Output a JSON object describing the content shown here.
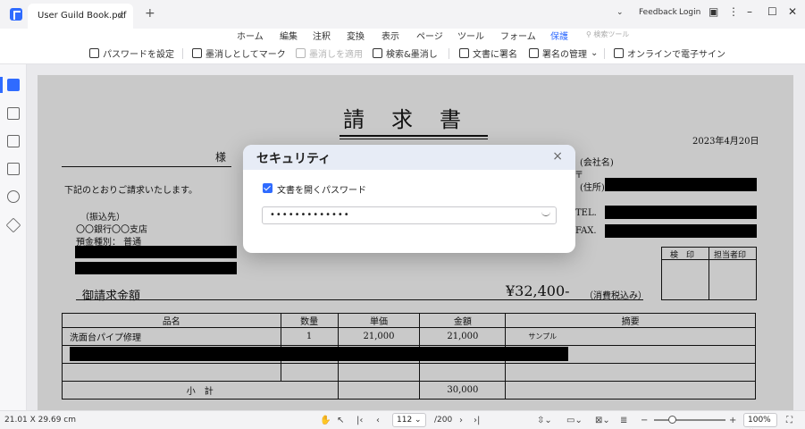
{
  "titlebar": {
    "tab_title": "User Guild Book.pdf",
    "tab_close": "×",
    "new_tab": "+",
    "feedback": "Feedback",
    "login": "Login"
  },
  "menu": {
    "items": [
      "ホーム",
      "編集",
      "注釈",
      "変換",
      "表示",
      "ページ",
      "ツール",
      "フォーム",
      "保護"
    ],
    "active": "保護",
    "search_tools": "検索ツール"
  },
  "toolbar": {
    "set_password": "パスワードを設定",
    "mark_redaction": "墨消しとしてマーク",
    "apply_redaction": "墨消しを適用",
    "search_redact": "検索&墨消し",
    "sign_document": "文書に署名",
    "manage_signatures": "署名の管理",
    "online_esign": "オンラインで電子サイン"
  },
  "document": {
    "title": "請求書",
    "date": "2023年4月20日",
    "customer_suffix": "様",
    "company_label": "(会社名)",
    "postal_mark": "〒",
    "address_label": "(住所)",
    "tel_label": "TEL.",
    "fax_label": "FAX.",
    "intro": "下記のとおりご請求いたします。",
    "bank_heading": "（振込先）",
    "bank_name": "〇〇銀行〇〇支店",
    "account_type": "預金種別： 普通",
    "stamp_label": "検　印",
    "person_label": "担当者印",
    "amount_label": "御請求金額",
    "amount_value": "¥32,400-",
    "tax_note": "（消費税込み）",
    "table": {
      "headers": [
        "品名",
        "数量",
        "単価",
        "金額",
        "摘要"
      ],
      "row1": [
        "洗面台パイプ修理",
        "1",
        "21,000",
        "21,000",
        "サンプル"
      ],
      "subtotal_label": "小　計",
      "subtotal_value": "30,000"
    }
  },
  "dialog": {
    "title": "セキュリティ",
    "close": "×",
    "checkbox_label": "文書を開くパスワード",
    "checkbox_checked": true,
    "password_value": "•••••••••••••"
  },
  "statusbar": {
    "page_size": "21.01 X 29.69 cm",
    "current_page": "112",
    "total_pages": "/200",
    "zoom": "100%",
    "zoom_level": 0.2
  },
  "colors": {
    "accent": "#2f6bff",
    "page_bg": "#c9c9c9",
    "redaction": "#000000"
  }
}
